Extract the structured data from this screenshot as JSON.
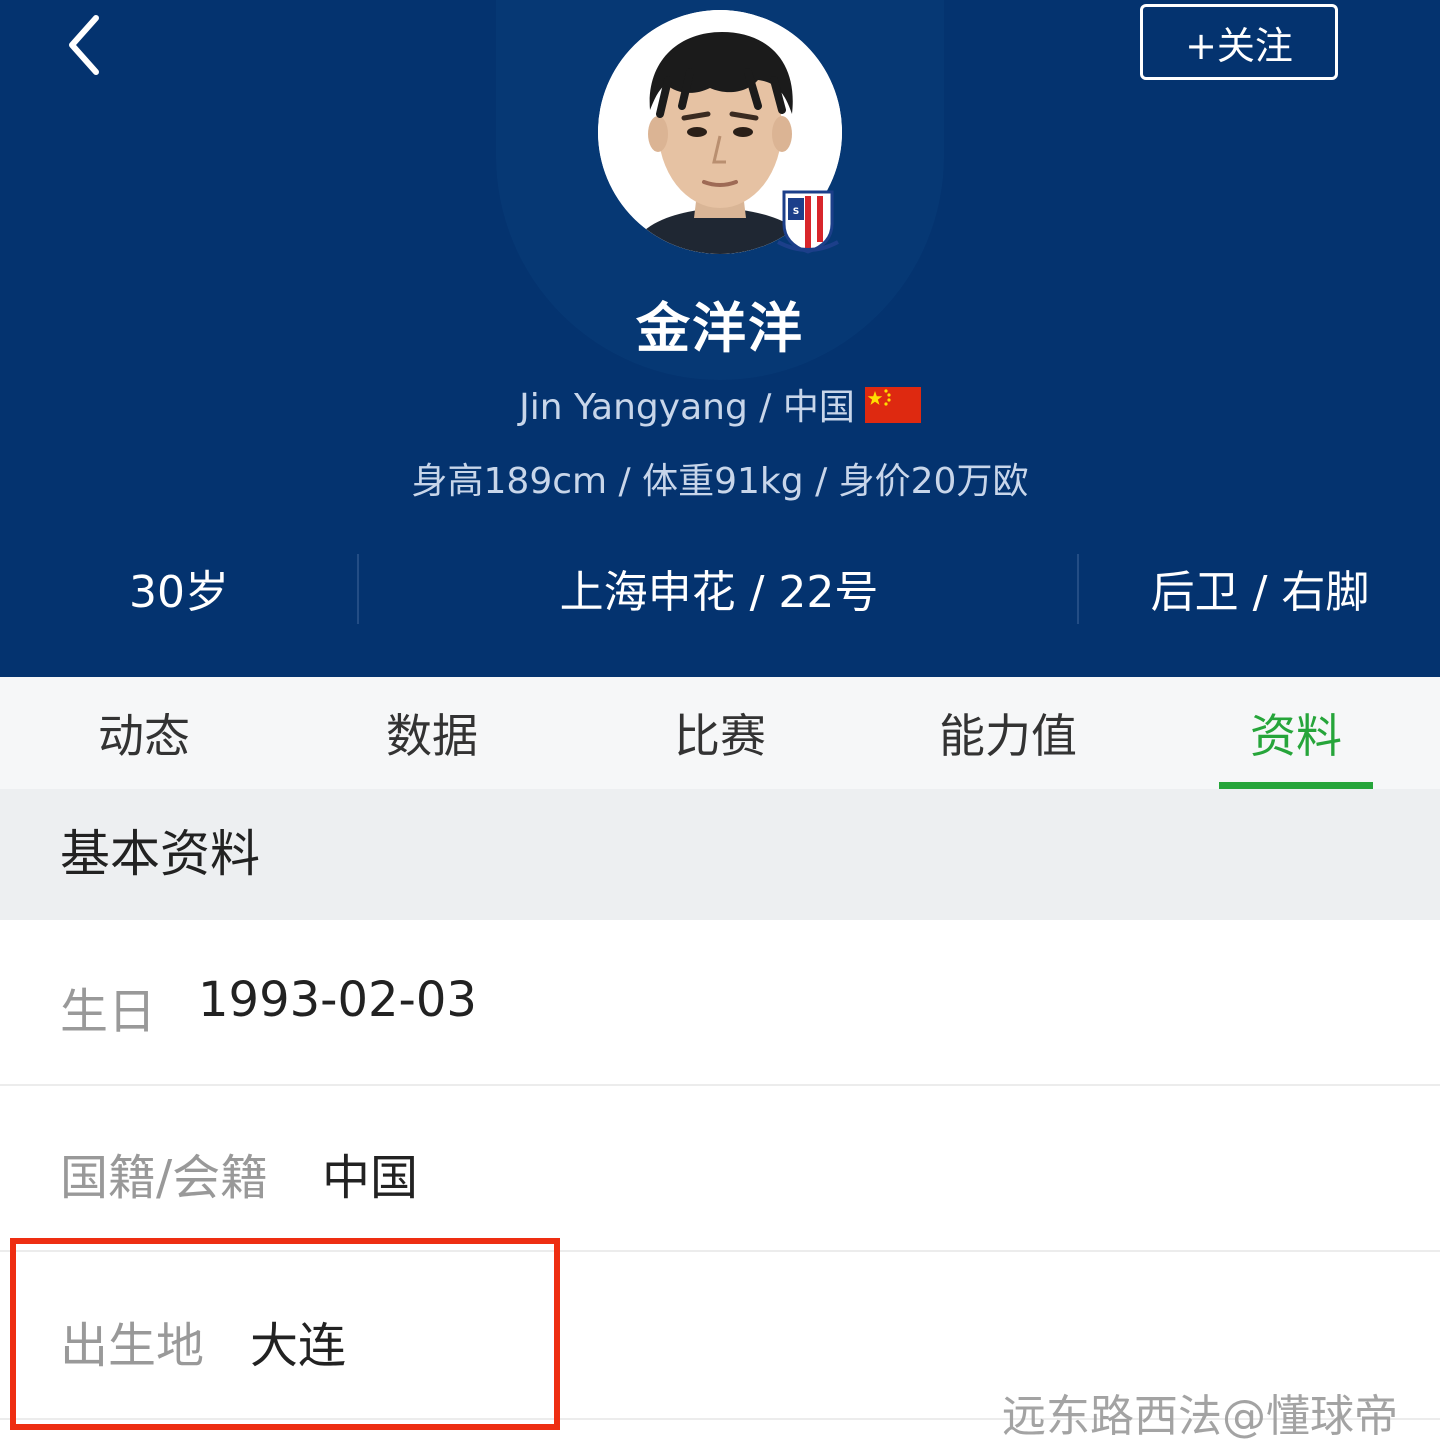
{
  "header": {
    "follow_label": "+关注",
    "player_name": "金洋洋",
    "english_name": "Jin Yangyang",
    "nationality": "中国",
    "separator": " / ",
    "stats_line": "身高189cm / 体重91kg / 身价20万欧",
    "age": "30岁",
    "club_number": "上海申花 / 22号",
    "position_foot": "后卫 / 右脚",
    "background_color": "#04336f"
  },
  "tabs": [
    {
      "label": "动态",
      "active": false
    },
    {
      "label": "数据",
      "active": false
    },
    {
      "label": "比赛",
      "active": false
    },
    {
      "label": "能力值",
      "active": false
    },
    {
      "label": "资料",
      "active": true
    }
  ],
  "accent_color": "#26a53a",
  "section": {
    "title": "基本资料"
  },
  "info": {
    "birthday": {
      "label": "生日",
      "value": "1993-02-03"
    },
    "nationality": {
      "label": "国籍/会籍",
      "value": "中国"
    },
    "birthplace": {
      "label": "出生地",
      "value": "大连"
    }
  },
  "highlight_color": "#ee2e12",
  "watermark": "远东路西法@懂球帝",
  "icons": {
    "back": "chevron-left-icon",
    "flag": "china-flag-icon",
    "badge": "shanghai-shenhua-badge-icon"
  }
}
